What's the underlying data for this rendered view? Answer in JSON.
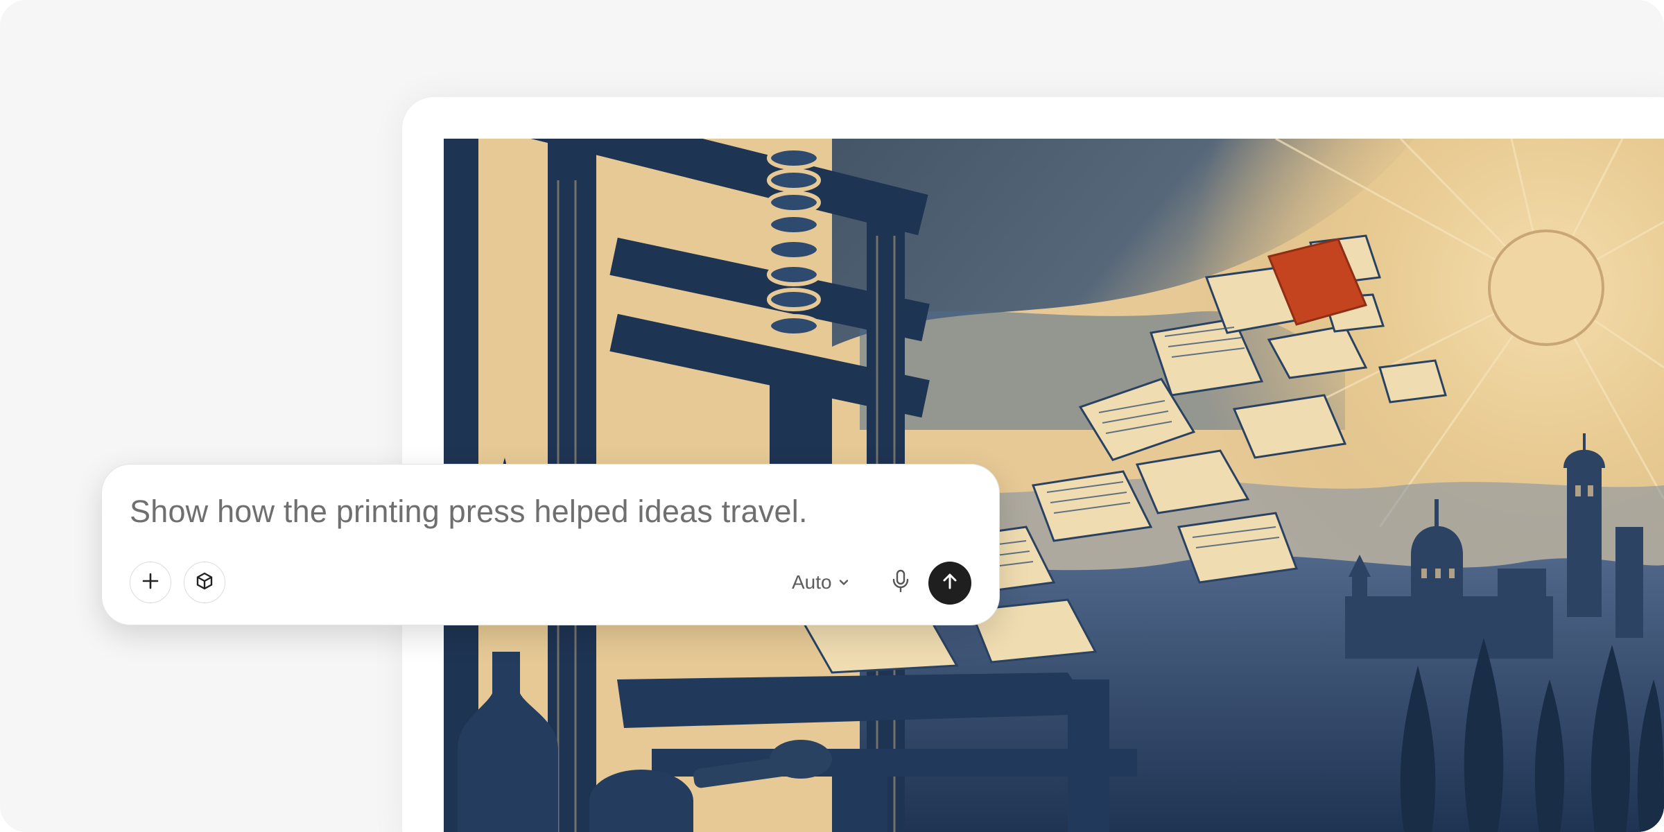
{
  "composer": {
    "prompt_text": "Show how the printing press helped ideas travel.",
    "model_label": "Auto"
  },
  "icons": {
    "add": "plus-icon",
    "tools": "cube-icon",
    "model_dropdown": "chevron-down-icon",
    "voice": "microphone-icon",
    "send": "arrow-up-icon"
  },
  "colors": {
    "page_background": "#f6f6f6",
    "card_background": "#ffffff",
    "send_button": "#1f1f1f",
    "artwork_paper": "#e9cf9f",
    "artwork_ink": "#1d3352",
    "artwork_accent": "#c4441f"
  }
}
